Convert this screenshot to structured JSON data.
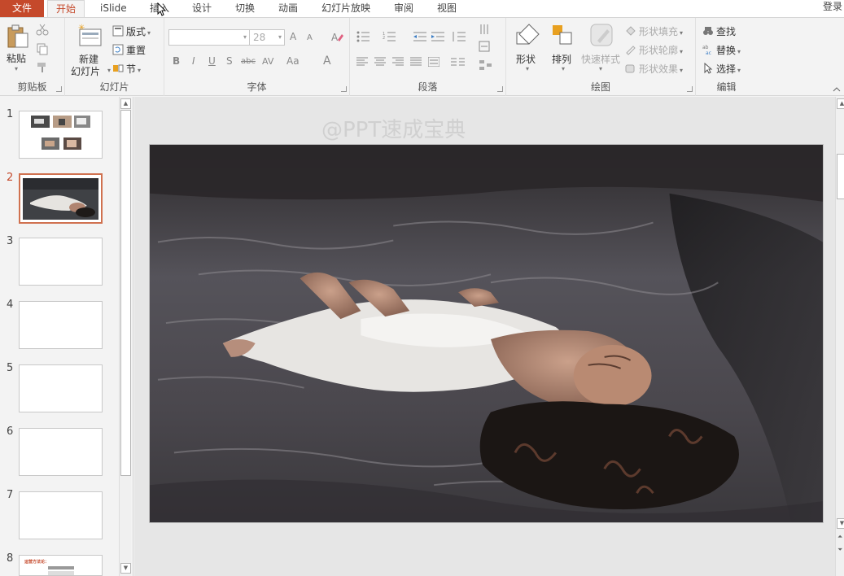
{
  "tabs": {
    "file": "文件",
    "items": [
      "开始",
      "iSlide",
      "插入",
      "设计",
      "切换",
      "动画",
      "幻灯片放映",
      "审阅",
      "视图"
    ],
    "active_index": 0,
    "login": "登录"
  },
  "ribbon": {
    "clipboard": {
      "label": "剪贴板",
      "paste": "粘贴"
    },
    "slides": {
      "label": "幻灯片",
      "new_slide_1": "新建",
      "new_slide_2": "幻灯片",
      "layout": "版式",
      "reset": "重置",
      "section": "节"
    },
    "font": {
      "label": "字体",
      "font_name": "",
      "font_size": "28",
      "bold": "B",
      "italic": "I",
      "underline": "U",
      "shadow": "S",
      "strike": "abc",
      "spacing": "AV",
      "case": "Aa",
      "color": "A",
      "grow": "A",
      "shrink": "A"
    },
    "paragraph": {
      "label": "段落"
    },
    "drawing": {
      "label": "绘图",
      "shape": "形状",
      "arrange": "排列",
      "quick_styles": "快速样式",
      "shape_fill": "形状填充",
      "shape_outline": "形状轮廓",
      "shape_effects": "形状效果"
    },
    "editing": {
      "label": "编辑",
      "find": "查找",
      "replace": "替换",
      "select": "选择"
    }
  },
  "thumbnails": {
    "numbers": [
      "1",
      "2",
      "3",
      "4",
      "5",
      "6",
      "7",
      "8"
    ],
    "selected": "2",
    "slide8_title": "运营方法论："
  },
  "editor": {
    "watermark": "@PPT速成宝典"
  },
  "colors": {
    "accent": "#c5492b",
    "selection_border": "#d0714f"
  }
}
